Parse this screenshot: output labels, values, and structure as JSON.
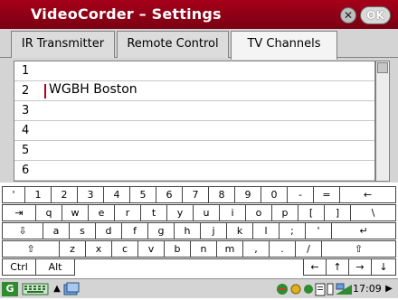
{
  "window": {
    "title": "VideoCorder – Settings",
    "close_label": "✕",
    "ok_label": "OK"
  },
  "tabs": [
    {
      "label": "IR Transmitter"
    },
    {
      "label": "Remote Control"
    },
    {
      "label": "TV Channels"
    }
  ],
  "channels": [
    {
      "num": "1",
      "name": ""
    },
    {
      "num": "2",
      "name": "WGBH Boston"
    },
    {
      "num": "3",
      "name": ""
    },
    {
      "num": "4",
      "name": ""
    },
    {
      "num": "5",
      "name": ""
    },
    {
      "num": "6",
      "name": ""
    }
  ],
  "keyboard": {
    "row1": [
      "'",
      "1",
      "2",
      "3",
      "4",
      "5",
      "6",
      "7",
      "8",
      "9",
      "0",
      "-",
      "=",
      "←"
    ],
    "row2": [
      "⇥",
      "q",
      "w",
      "e",
      "r",
      "t",
      "y",
      "u",
      "i",
      "o",
      "p",
      "[",
      "]",
      "\\"
    ],
    "row3": [
      "⇩",
      "a",
      "s",
      "d",
      "f",
      "g",
      "h",
      "j",
      "k",
      "l",
      ";",
      "'",
      "↵"
    ],
    "row4": [
      "⇧",
      "z",
      "x",
      "c",
      "v",
      "b",
      "n",
      "m",
      ",",
      ".",
      "/",
      "⇧"
    ],
    "row5": [
      "Ctrl",
      "Alt",
      "",
      "←",
      "↑",
      "→",
      "↓"
    ]
  },
  "status": {
    "time": "17:09",
    "arrow": "▲",
    "play": "▶"
  }
}
